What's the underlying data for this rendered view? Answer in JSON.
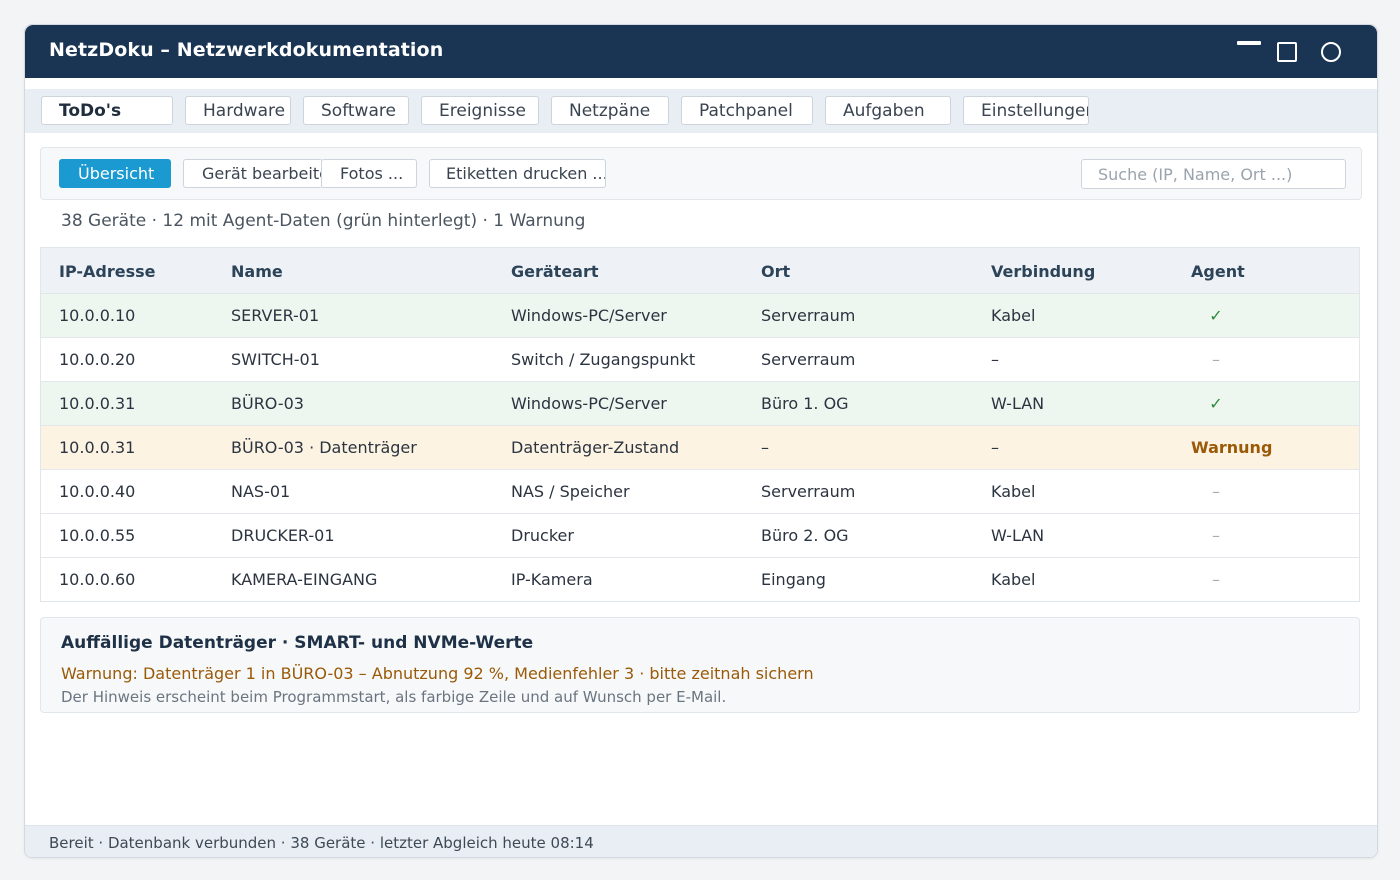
{
  "window": {
    "title": "NetzDoku – Netzwerkdokumentation"
  },
  "tabs": [
    {
      "label": "ToDo's",
      "active": true
    },
    {
      "label": "Hardware"
    },
    {
      "label": "Software"
    },
    {
      "label": "Ereignisse"
    },
    {
      "label": "Netzpäne"
    },
    {
      "label": "Patchpanel"
    },
    {
      "label": "Aufgaben"
    },
    {
      "label": "Einstellungen"
    }
  ],
  "toolbar": {
    "overview_label": "Übersicht",
    "edit_label": "Gerät bearbeiten",
    "photos_label": "Fotos ...",
    "print_label": "Etiketten drucken ...",
    "search_placeholder": "Suche (IP, Name, Ort ...)"
  },
  "summary": "38 Geräte · 12 mit Agent-Daten (grün hinterlegt) · 1 Warnung",
  "table": {
    "headers": {
      "ip": "IP-Adresse",
      "name": "Name",
      "type": "Geräteart",
      "location": "Ort",
      "connection": "Verbindung",
      "agent": "Agent"
    },
    "rows": [
      {
        "ip": "10.0.0.10",
        "name": "SERVER-01",
        "type": "Windows-PC/Server",
        "location": "Serverraum",
        "connection": "Kabel",
        "agent": "✓"
      },
      {
        "ip": "10.0.0.20",
        "name": "SWITCH-01",
        "type": "Switch / Zugangspunkt",
        "location": "Serverraum",
        "connection": "–",
        "agent": "–"
      },
      {
        "ip": "10.0.0.31",
        "name": "BÜRO-03",
        "type": "Windows-PC/Server",
        "location": "Büro 1. OG",
        "connection": "W-LAN",
        "agent": "✓"
      },
      {
        "ip": "10.0.0.31",
        "name": "BÜRO-03 · Datenträger",
        "type": "Datenträger-Zustand",
        "location": "–",
        "connection": "–",
        "agent": "Warnung"
      },
      {
        "ip": "10.0.0.40",
        "name": "NAS-01",
        "type": "NAS / Speicher",
        "location": "Serverraum",
        "connection": "Kabel",
        "agent": "–"
      },
      {
        "ip": "10.0.0.55",
        "name": "DRUCKER-01",
        "type": "Drucker",
        "location": "Büro 2. OG",
        "connection": "W-LAN",
        "agent": "–"
      },
      {
        "ip": "10.0.0.60",
        "name": "KAMERA-EINGANG",
        "type": "IP-Kamera",
        "location": "Eingang",
        "connection": "Kabel",
        "agent": "–"
      }
    ]
  },
  "alert": {
    "title": "Auffällige Datenträger · SMART- und NVMe-Werte",
    "warning": "Warnung: Datenträger 1 in BÜRO-03 – Abnutzung 92 %, Medienfehler 3 · bitte zeitnah sichern",
    "hint": "Der Hinweis erscheint beim Programmstart, als farbige Zeile und auf Wunsch per E-Mail."
  },
  "status": "Bereit · Datenbank verbunden · 38 Geräte · letzter Abgleich heute 08:14",
  "colors": {
    "titlebar": "#1a3553",
    "accent": "#1b9ad1",
    "agent_row": "#eef7ef",
    "warning_row": "#fdf3e3",
    "warning_text": "#9a5a07",
    "ok_check": "#2e8b3a"
  }
}
